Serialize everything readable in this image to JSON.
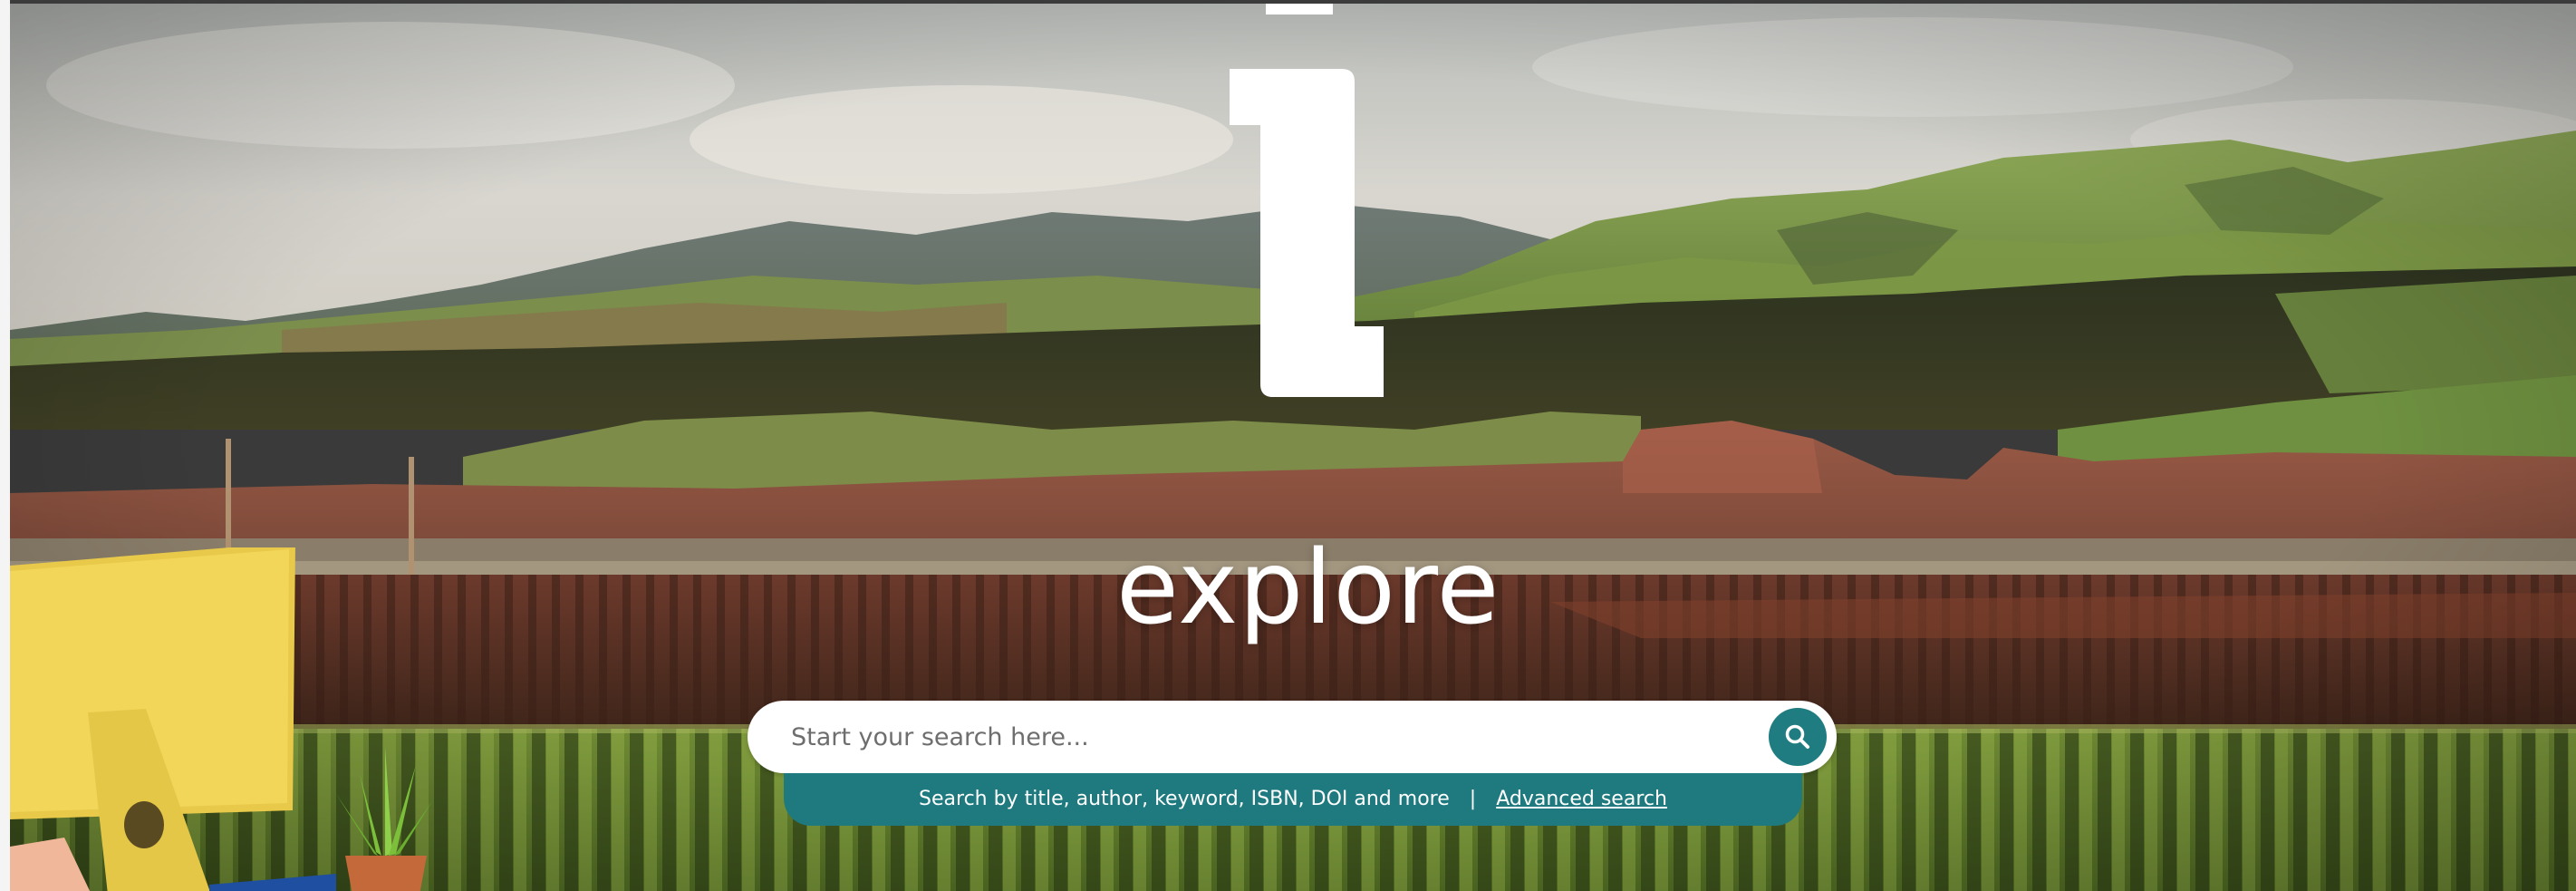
{
  "hero": {
    "title": "explore"
  },
  "search": {
    "placeholder": "Start your search here...",
    "value": "",
    "button_icon": "search-icon",
    "helper_text": "Search by title, author, keyword, ISBN, DOI and more",
    "separator": "|",
    "advanced_link": "Advanced search"
  },
  "colors": {
    "accent": "#1f7d82",
    "helper_bar": "#1e7a7f",
    "title": "#ffffff"
  }
}
